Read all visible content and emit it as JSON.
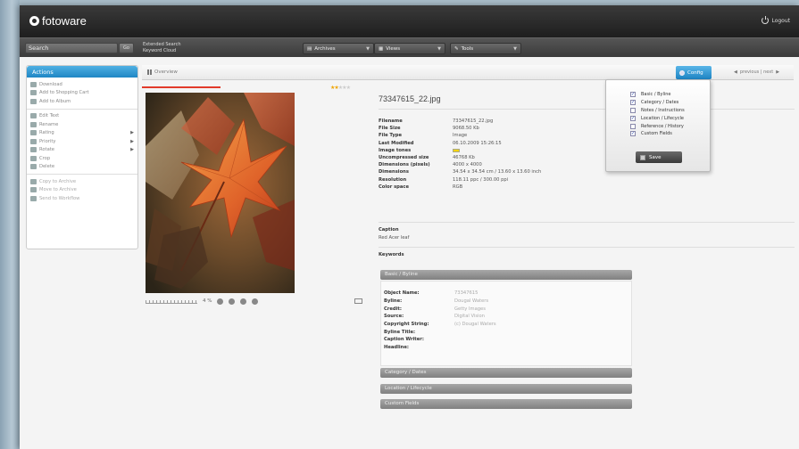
{
  "app": {
    "name": "fotoware",
    "logout": "Logout"
  },
  "nav": {
    "search_placeholder": "Search",
    "go": "Go",
    "extended_search": "Extended Search",
    "keyword_cloud": "Keyword Cloud",
    "menus": [
      {
        "label": "Archives"
      },
      {
        "label": "Views"
      },
      {
        "label": "Tools"
      }
    ]
  },
  "actions": {
    "title": "Actions",
    "groups": [
      [
        "Download",
        "Add to Shopping Cart",
        "Add to Album"
      ],
      [
        "Edit Text",
        "Rename",
        "Rating",
        "Priority",
        "Rotate",
        "Crop",
        "Delete"
      ],
      [
        "Copy to Archive",
        "Move to Archive",
        "Send to Workflow"
      ]
    ]
  },
  "overview": {
    "label": "Overview",
    "config": "Config",
    "pager": "previous | next"
  },
  "file": {
    "title": "73347615_22.jpg",
    "meta": [
      {
        "k": "Filename",
        "v": "73347615_22.jpg"
      },
      {
        "k": "File Size",
        "v": "9068.50 Kb"
      },
      {
        "k": "File Type",
        "v": "Image"
      },
      {
        "k": "Last Modified",
        "v": "06.10.2009 15:26:15"
      },
      {
        "k": "Image tones",
        "v": ""
      },
      {
        "k": "Uncompressed size",
        "v": "46768 Kb"
      },
      {
        "k": "Dimensions (pixels)",
        "v": "4000 x 4000"
      },
      {
        "k": "Dimensions",
        "v": "34.54 x 34.54 cm / 13.60 x 13.60 inch"
      },
      {
        "k": "Resolution",
        "v": "118.11 ppc / 300.00 ppi"
      },
      {
        "k": "Color space",
        "v": "RGB"
      }
    ],
    "caption_label": "Caption",
    "caption_value": "Red Acer leaf",
    "keywords_label": "Keywords",
    "image_tone_color": "#f5d40b"
  },
  "toolbar": {
    "zoom": "4 %"
  },
  "rating": {
    "stars": 2,
    "max": 5
  },
  "sections": {
    "basic": "Basic / Byline",
    "category": "Category / Dates",
    "location": "Location / Lifecycle",
    "custom": "Custom Fields"
  },
  "basic_fields": [
    {
      "k": "Object Name:",
      "v": "73347615"
    },
    {
      "k": "Byline:",
      "v": "Dougal Waters"
    },
    {
      "k": "Credit:",
      "v": "Getty Images"
    },
    {
      "k": "Source:",
      "v": "Digital Vision"
    },
    {
      "k": "Copyright String:",
      "v": "(c) Dougal Waters"
    },
    {
      "k": "Byline Title:",
      "v": ""
    },
    {
      "k": "Caption Writer:",
      "v": ""
    },
    {
      "k": "Headline:",
      "v": ""
    }
  ],
  "config_popup": {
    "items": [
      {
        "label": "Basic / Byline",
        "checked": true
      },
      {
        "label": "Category / Dates",
        "checked": true
      },
      {
        "label": "Notes / Instructions",
        "checked": false
      },
      {
        "label": "Location / Lifecycle",
        "checked": true
      },
      {
        "label": "Reference / History",
        "checked": false
      },
      {
        "label": "Custom Fields",
        "checked": true
      }
    ],
    "save": "Save"
  },
  "colors": {
    "accent": "#1f86c4",
    "progress": "#e23a2a"
  }
}
